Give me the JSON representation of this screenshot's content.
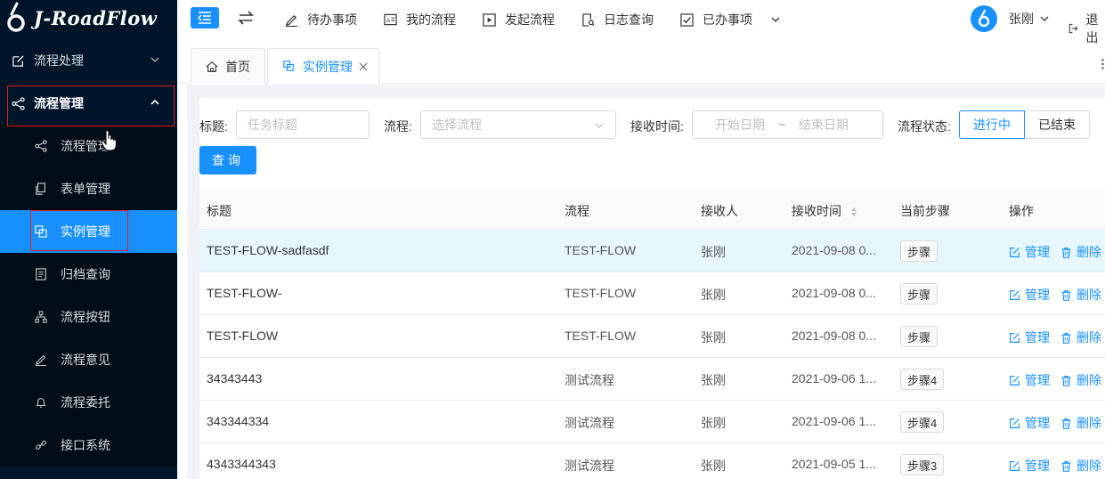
{
  "app": {
    "logo_text": "J-RoadFlow"
  },
  "sidebar": {
    "items": [
      {
        "label": "流程处理",
        "icon": "edit-square-icon"
      },
      {
        "label": "流程管理",
        "icon": "share-nodes-icon"
      },
      {
        "label": "流程管理",
        "icon": "share-nodes-icon"
      },
      {
        "label": "表单管理",
        "icon": "copy-icon"
      },
      {
        "label": "实例管理",
        "icon": "block-copy-icon"
      },
      {
        "label": "归档查询",
        "icon": "file-text-icon"
      },
      {
        "label": "流程按钮",
        "icon": "cluster-icon"
      },
      {
        "label": "流程意见",
        "icon": "pen-icon"
      },
      {
        "label": "流程委托",
        "icon": "bell-icon"
      },
      {
        "label": "接口系统",
        "icon": "link-icon"
      }
    ]
  },
  "topnav": {
    "items": [
      {
        "label": "待办事项",
        "icon": "pen-icon"
      },
      {
        "label": "我的流程",
        "icon": "id-card-icon"
      },
      {
        "label": "发起流程",
        "icon": "play-square-icon"
      },
      {
        "label": "日志查询",
        "icon": "file-search-icon"
      },
      {
        "label": "已办事项",
        "icon": "check-square-icon"
      }
    ],
    "user_name": "张刚",
    "logout": "退出"
  },
  "tabs": [
    {
      "label": "首页",
      "icon": "home-icon"
    },
    {
      "label": "实例管理",
      "icon": "block-copy-icon"
    }
  ],
  "filters": {
    "title_label": "标题:",
    "title_placeholder": "任务标题",
    "flow_label": "流程:",
    "flow_placeholder": "选择流程",
    "time_label": "接收时间:",
    "start_placeholder": "开始日期",
    "range_sep": "~",
    "end_placeholder": "结束日期",
    "status_label": "流程状态:",
    "status_options": [
      "进行中",
      "已结束"
    ],
    "status_selected": "进行中",
    "query_button": "查询"
  },
  "table": {
    "columns": [
      "标题",
      "流程",
      "接收人",
      "接收时间",
      "当前步骤",
      "操作"
    ],
    "rows": [
      {
        "title": "TEST-FLOW-sadfasdf",
        "flow": "TEST-FLOW",
        "receiver": "张刚",
        "time": "2021-09-08 0...",
        "step": "步骤"
      },
      {
        "title": "TEST-FLOW-",
        "flow": "TEST-FLOW",
        "receiver": "张刚",
        "time": "2021-09-08 0...",
        "step": "步骤"
      },
      {
        "title": "TEST-FLOW",
        "flow": "TEST-FLOW",
        "receiver": "张刚",
        "time": "2021-09-08 0...",
        "step": "步骤"
      },
      {
        "title": "34343443",
        "flow": "测试流程",
        "receiver": "张刚",
        "time": "2021-09-06 1...",
        "step": "步骤4"
      },
      {
        "title": "343344334",
        "flow": "测试流程",
        "receiver": "张刚",
        "time": "2021-09-06 1...",
        "step": "步骤4"
      },
      {
        "title": "4343344343",
        "flow": "测试流程",
        "receiver": "张刚",
        "time": "2021-09-05 1...",
        "step": "步骤3"
      }
    ],
    "actions": {
      "manage": "管理",
      "delete": "删除"
    }
  },
  "colors": {
    "primary": "#1890ff",
    "sidebar_bg": "#001529",
    "highlight_row": "#e6f7ff",
    "annotation": "#e02020"
  }
}
